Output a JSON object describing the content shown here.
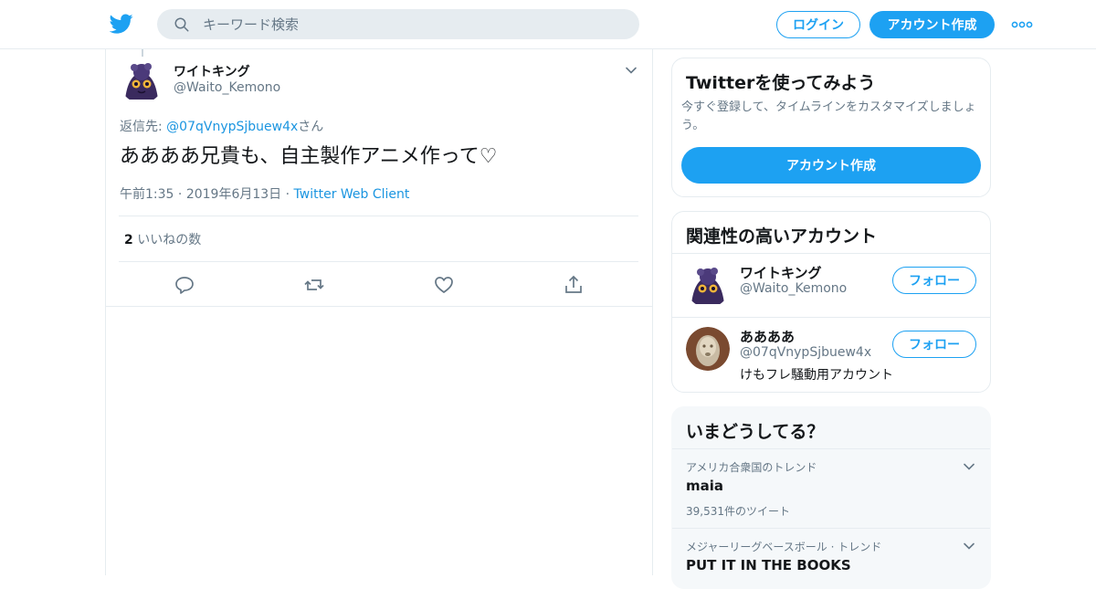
{
  "header": {
    "logo_icon": "twitter-bird-icon",
    "search": {
      "placeholder": "キーワード検索"
    },
    "login_label": "ログイン",
    "signup_label": "アカウント作成",
    "more_icon": "more-dots-icon",
    "accent": "#1da1f2"
  },
  "tweet": {
    "author_name": "ワイトキング",
    "author_handle": "@Waito_Kemono",
    "reply_prefix": "返信先: ",
    "reply_to": "@07qVnypSjbuew4x",
    "reply_suffix": "さん",
    "text": "ああああ兄貴も、自主製作アニメ作って♡",
    "time": "午前1:35",
    "date": "2019年6月13日",
    "client": "Twitter Web Client",
    "like_count": "2",
    "like_label": "いいねの数"
  },
  "sidebar": {
    "signup_card": {
      "title": "Twitterを使ってみよう",
      "description": "今すぐ登録して、タイムラインをカスタマイズしましょう。",
      "button_label": "アカウント作成"
    },
    "related": {
      "title": "関連性の高いアカウント",
      "accounts": [
        {
          "name": "ワイトキング",
          "handle": "@Waito_Kemono",
          "bio": "",
          "follow_label": "フォロー"
        },
        {
          "name": "ああああ",
          "handle": "@07qVnypSjbuew4x",
          "bio": "けもフレ騒動用アカウント",
          "follow_label": "フォロー"
        }
      ]
    },
    "trends": {
      "title": "いまどうしてる？",
      "items": [
        {
          "context": "アメリカ合衆国のトレンド",
          "name": "maia",
          "count": "39,531件のツイート"
        },
        {
          "context": "メジャーリーグベースボール · トレンド",
          "name": "PUT IT IN THE BOOKS",
          "count": ""
        }
      ]
    }
  }
}
